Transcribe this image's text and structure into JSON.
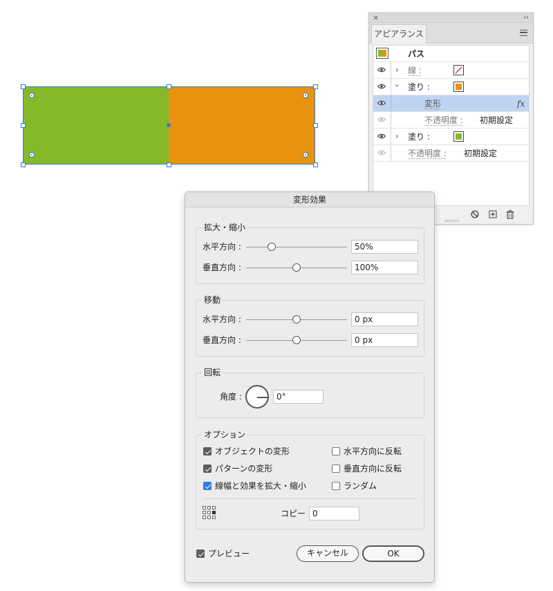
{
  "canvas": {
    "colors": {
      "green": "#86b92a",
      "orange": "#e8920e",
      "selection": "#2a7bd6"
    }
  },
  "appearance_panel": {
    "close_glyph": "×",
    "collapse_glyph": "‹‹",
    "tab_label": "アピアランス",
    "menu_icon": "hamburger-icon",
    "object_label": "パス",
    "rows": [
      {
        "label": "線 :",
        "swatch": "stroke-none"
      },
      {
        "label": "塗り :",
        "swatch": "orange"
      },
      {
        "label": "変形",
        "fx": "fx"
      },
      {
        "label": "不透明度 :",
        "value": "初期設定"
      },
      {
        "label": "塗り :",
        "swatch": "green"
      },
      {
        "label": "不透明度 :",
        "value": "初期設定"
      }
    ],
    "bottom_icons": [
      "clear-icon",
      "add-icon",
      "trash-icon"
    ]
  },
  "dialog": {
    "title": "変形効果",
    "scale": {
      "title": "拡大・縮小",
      "horizontal": {
        "label": "水平方向 :",
        "value": "50%",
        "slider": 0.25
      },
      "vertical": {
        "label": "垂直方向 :",
        "value": "100%",
        "slider": 0.5
      }
    },
    "move": {
      "title": "移動",
      "horizontal": {
        "label": "水平方向 :",
        "value": "0 px",
        "slider": 0.5
      },
      "vertical": {
        "label": "垂直方向 :",
        "value": "0 px",
        "slider": 0.5
      }
    },
    "rotate": {
      "title": "回転",
      "angle_label": "角度 :",
      "angle_value": "0°"
    },
    "options": {
      "title": "オプション",
      "transform_objects": {
        "label": "オブジェクトの変形",
        "checked": true
      },
      "transform_patterns": {
        "label": "パターンの変形",
        "checked": true
      },
      "scale_strokes": {
        "label": "線幅と効果を拡大・縮小",
        "checked": true
      },
      "reflect_x": {
        "label": "水平方向に反転",
        "checked": false
      },
      "reflect_y": {
        "label": "垂直方向に反転",
        "checked": false
      },
      "random": {
        "label": "ランダム",
        "checked": false
      },
      "copies_label": "コピー",
      "copies_value": "0"
    },
    "preview": {
      "label": "プレビュー",
      "checked": true
    },
    "cancel_label": "キャンセル",
    "ok_label": "OK"
  }
}
